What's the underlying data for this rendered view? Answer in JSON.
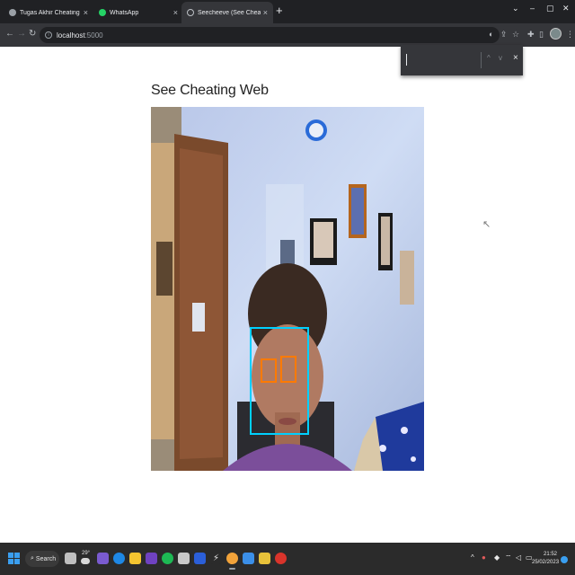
{
  "browser": {
    "tabs": [
      {
        "title": "Tugas Akhir Cheating Detection",
        "favicon_color": "#9aa0a6",
        "active": false
      },
      {
        "title": "WhatsApp",
        "favicon_color": "#25d366",
        "active": false
      },
      {
        "title": "Seecheeve (See Cheating Web)",
        "favicon_color": "#bdc1c6",
        "active": true
      }
    ],
    "url_host": "localhost",
    "url_port": ":5000",
    "tab_close_glyph": "×",
    "new_tab_glyph": "+"
  },
  "find_bar": {
    "query": "",
    "up_glyph": "^",
    "down_glyph": "v",
    "close_glyph": "×"
  },
  "page": {
    "title": "See Cheating Web"
  },
  "taskbar": {
    "search_label": "Search",
    "weather_temp": "29°",
    "time": "21:52",
    "date": "25/02/2023",
    "lang": "ENG"
  },
  "colors": {
    "face_box": "#00d0ff",
    "eye_box": "#ff7a00",
    "browser_dark": "#202124",
    "toolbar": "#35363a"
  }
}
